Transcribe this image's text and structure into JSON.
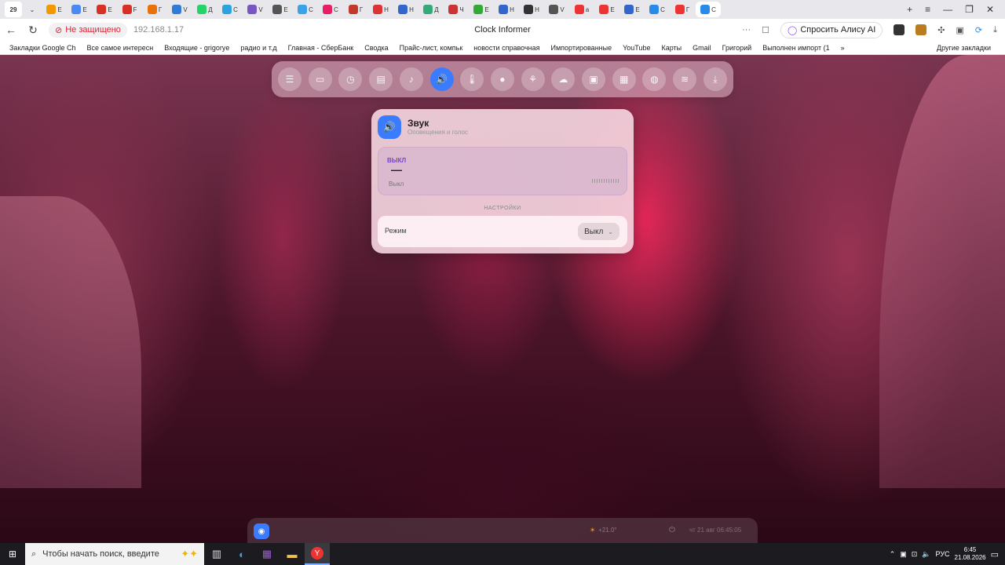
{
  "browser": {
    "tab_count_badge": "29",
    "tabs": [
      "E",
      "E",
      "E",
      "F",
      "Г",
      "V",
      "Д",
      "С",
      "V",
      "E",
      "С",
      "С",
      "Г",
      "Н",
      "Н",
      "Д",
      "Ч",
      "Е",
      "Н",
      "Н",
      "V",
      "а",
      "Е",
      "Е",
      "С",
      "Г",
      "С"
    ],
    "security_label": "Не защищено",
    "url": "192.168.1.17",
    "page_title": "Clock Informer",
    "alice_button": "Спросить Алису AI"
  },
  "bookmarks": {
    "items": [
      "Закладки Google Ch",
      "Все самое интересн",
      "Входящие - grigorye",
      "радио и т.д",
      "Главная - СберБанк",
      "Сводка",
      "Прайс-лист, компьк",
      "новости справочная",
      "Импортированные",
      "YouTube",
      "Карты",
      "Gmail",
      "Григорий",
      "Выполнен импорт (1"
    ],
    "more_label": "»",
    "other_label": "Другие закладки"
  },
  "toolbar": {
    "icons": [
      "sliders-icon",
      "display-icon",
      "clock-icon",
      "server-icon",
      "bell-icon",
      "speaker-icon",
      "thermometer-icon",
      "bulb-icon",
      "network-icon",
      "weather-icon",
      "camera-icon",
      "news-icon",
      "chat-icon",
      "wifi-icon",
      "download-icon"
    ],
    "active_index": 5
  },
  "card": {
    "title": "Звук",
    "subtitle": "Оповещения и голос",
    "status_label": "ВЫКЛ",
    "status_dash": "—",
    "status_value": "Выкл",
    "settings_heading": "НАСТРОЙКИ",
    "mode_label": "Режим",
    "mode_value": "Выкл"
  },
  "bottombar": {
    "weather": "+21.0°",
    "datetime": "чт 21 авг 06:45:05"
  },
  "taskbar": {
    "search_placeholder": "Чтобы начать поиск, введите",
    "tray_lang": "РУС",
    "time": "6:45",
    "date": "21.08.2026"
  },
  "colors": {
    "accent": "#3b7bff",
    "status_label": "#7a40d0",
    "security_warning": "#dd2233"
  }
}
